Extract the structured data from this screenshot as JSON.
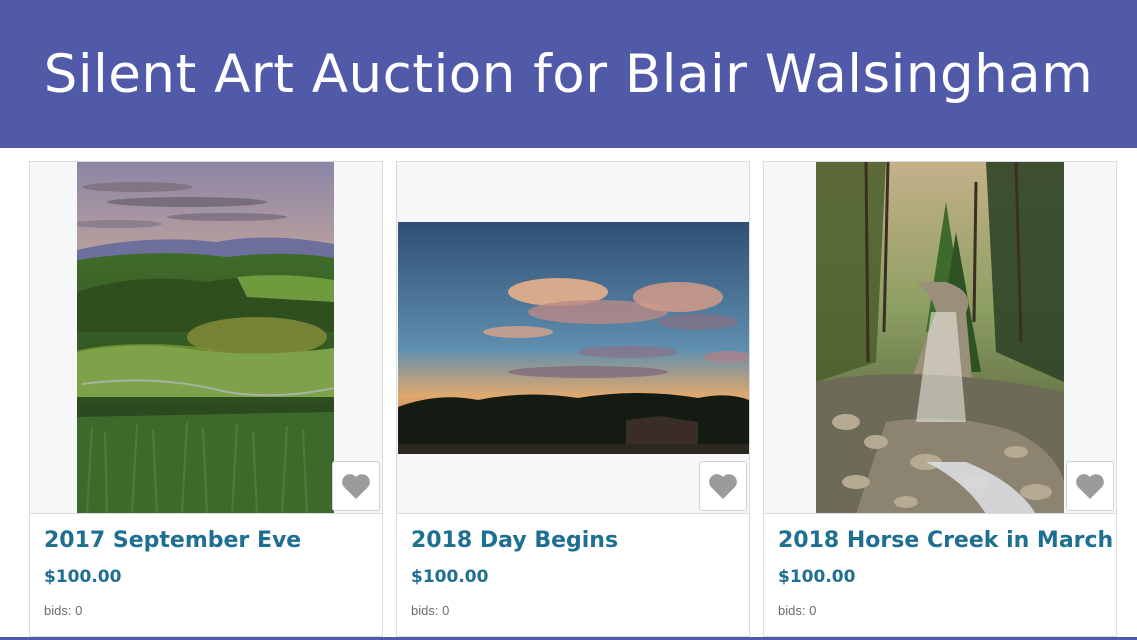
{
  "header": {
    "title": "Silent Art Auction for Blair Walsingham"
  },
  "theme": {
    "banner_color": "#5159a9",
    "title_color": "#1f6f93"
  },
  "items": [
    {
      "title": "2017 September Eve",
      "price": "$100.00",
      "bids_label": "bids: 0",
      "image": "landscape-painting"
    },
    {
      "title": "2018 Day Begins",
      "price": "$100.00",
      "bids_label": "bids: 0",
      "image": "sunrise-painting"
    },
    {
      "title": "2018 Horse Creek in March",
      "price": "$100.00",
      "bids_label": "bids: 0",
      "image": "creek-painting"
    }
  ],
  "icons": {
    "favorite": "heart-icon"
  }
}
